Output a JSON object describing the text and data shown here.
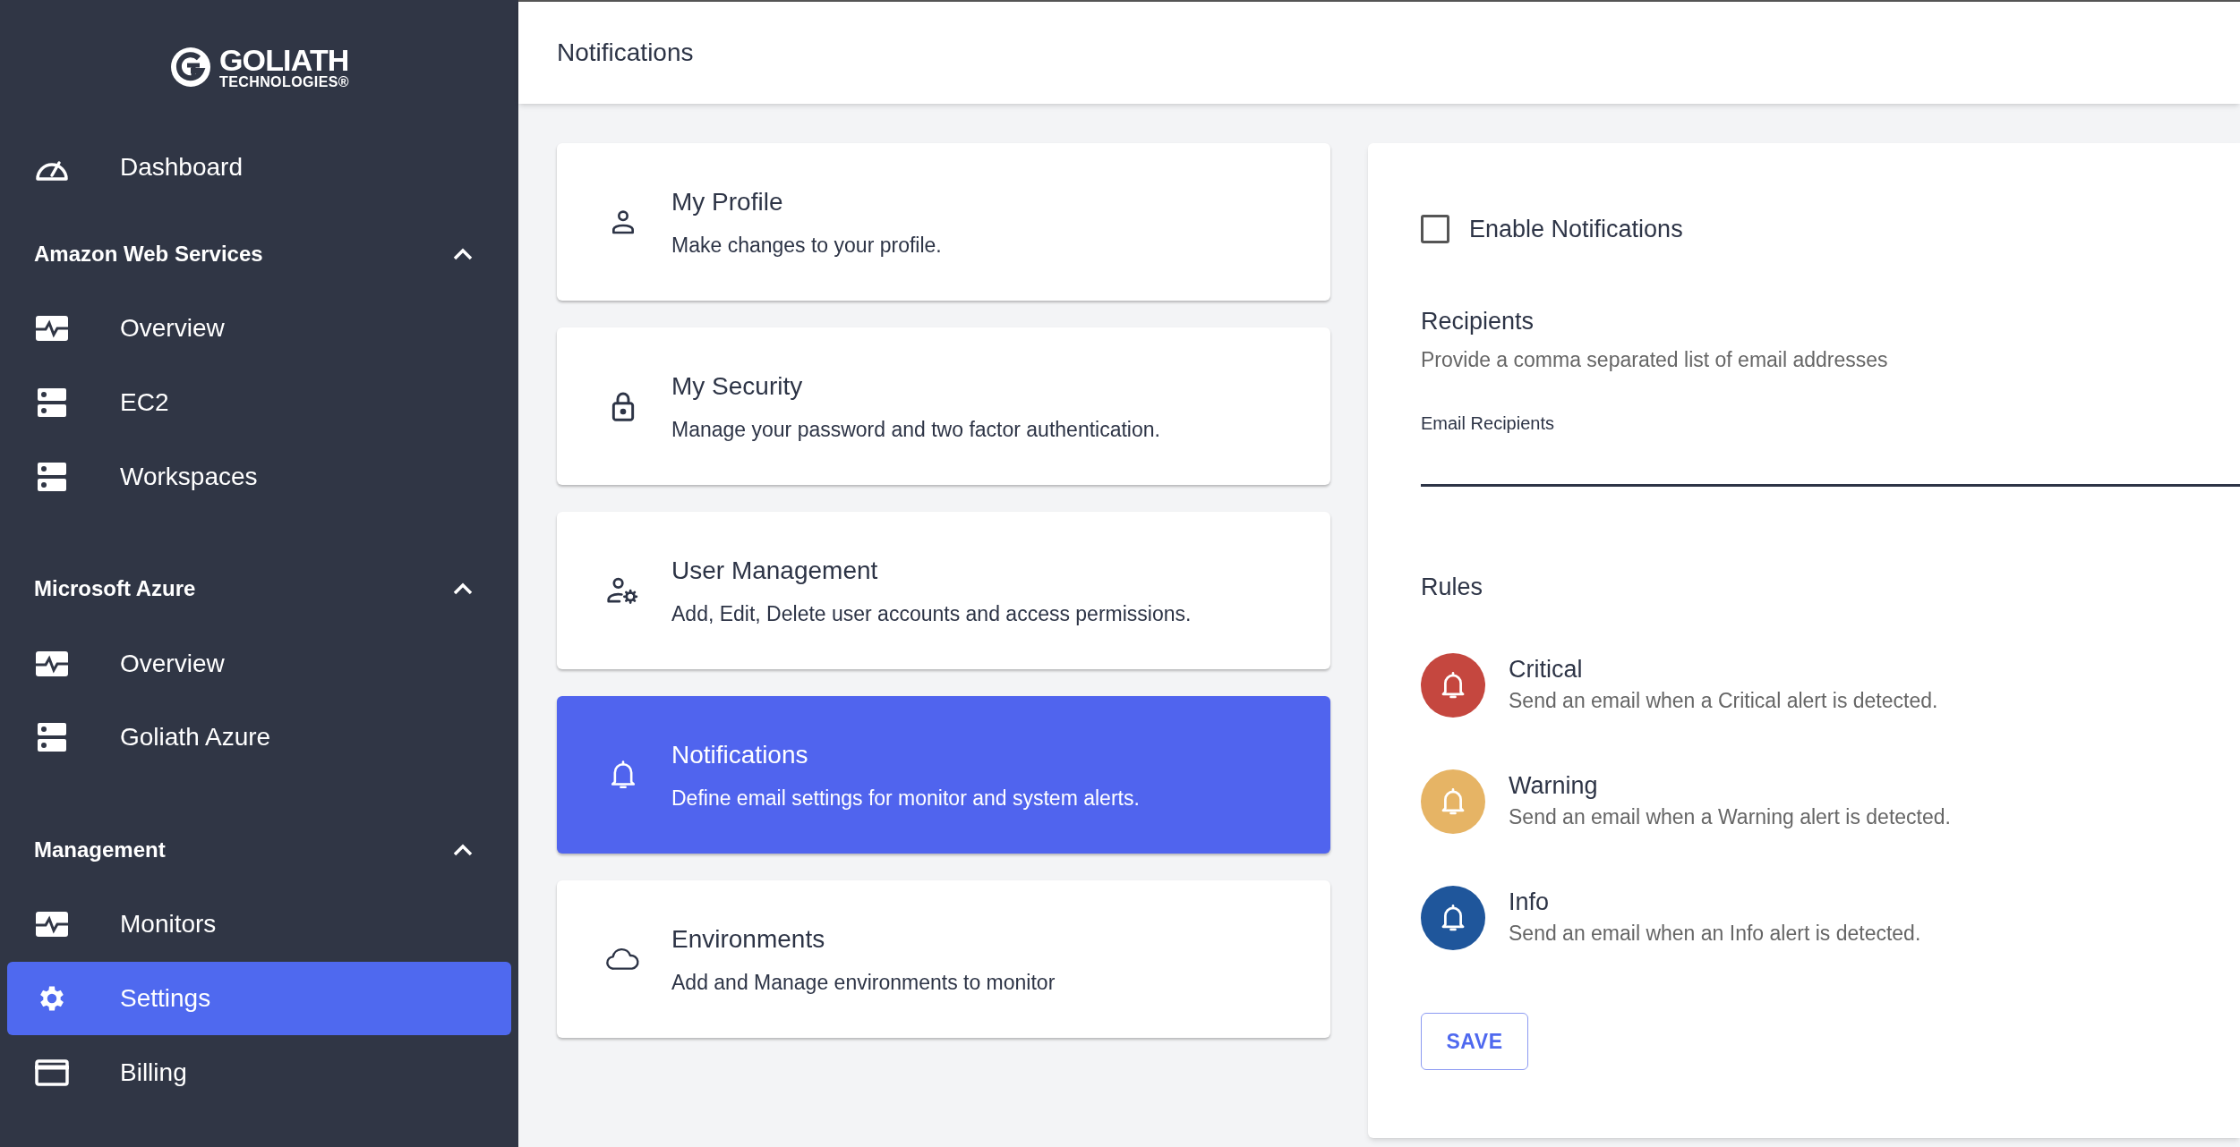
{
  "logo": {
    "name": "GOLIATH",
    "sub": "TECHNOLOGIES®"
  },
  "sidebar": [
    {
      "kind": "link",
      "items": [
        {
          "kind": "gauge",
          "label": "Dashboard",
          "selected": false
        }
      ]
    },
    {
      "kind": "group",
      "title": "Amazon Web Services",
      "expanded": true,
      "items": [
        {
          "kind": "pulse",
          "label": "Overview",
          "selected": false
        },
        {
          "kind": "server",
          "label": "EC2",
          "selected": false
        },
        {
          "kind": "server",
          "label": "Workspaces",
          "selected": false
        }
      ]
    },
    {
      "kind": "group",
      "title": "Microsoft Azure",
      "expanded": true,
      "items": [
        {
          "kind": "pulse",
          "label": "Overview",
          "selected": false
        },
        {
          "kind": "server",
          "label": "Goliath Azure",
          "selected": false
        }
      ]
    },
    {
      "kind": "group",
      "title": "Management",
      "expanded": true,
      "items": [
        {
          "kind": "pulse",
          "label": "Monitors",
          "selected": false
        },
        {
          "kind": "gear",
          "label": "Settings",
          "selected": true
        },
        {
          "kind": "card",
          "label": "Billing",
          "selected": false
        }
      ]
    }
  ],
  "header": {
    "title": "Notifications"
  },
  "cards": [
    {
      "kind": "person",
      "title": "My Profile",
      "description": "Make changes to your profile.",
      "selected": false
    },
    {
      "kind": "lock",
      "title": "My Security",
      "description": "Manage your password and two factor authentication.",
      "selected": false
    },
    {
      "kind": "user-gear",
      "title": "User Management",
      "description": "Add, Edit, Delete user accounts and access permissions.",
      "selected": false
    },
    {
      "kind": "bell",
      "title": "Notifications",
      "description": "Define email settings for monitor and system alerts.",
      "selected": true
    },
    {
      "kind": "cloud",
      "title": "Environments",
      "description": "Add and Manage environments to monitor",
      "selected": false
    }
  ],
  "panel": {
    "enable": {
      "label": "Enable Notifications",
      "checked": false
    },
    "recipients": {
      "title": "Recipients",
      "hint": "Provide a comma separated list of email addresses",
      "field_label": "Email Recipients",
      "focused": true
    },
    "rules": {
      "title": "Rules",
      "items": [
        {
          "name": "Critical",
          "description": "Send an email when a Critical alert is detected.",
          "color": "#c5473f"
        },
        {
          "name": "Warning",
          "description": "Send an email when a Warning alert is detected.",
          "color": "#e6b465"
        },
        {
          "name": "Info",
          "description": "Send an email when an Info alert is detected.",
          "color": "#1f569b"
        }
      ]
    },
    "save": "SAVE"
  }
}
